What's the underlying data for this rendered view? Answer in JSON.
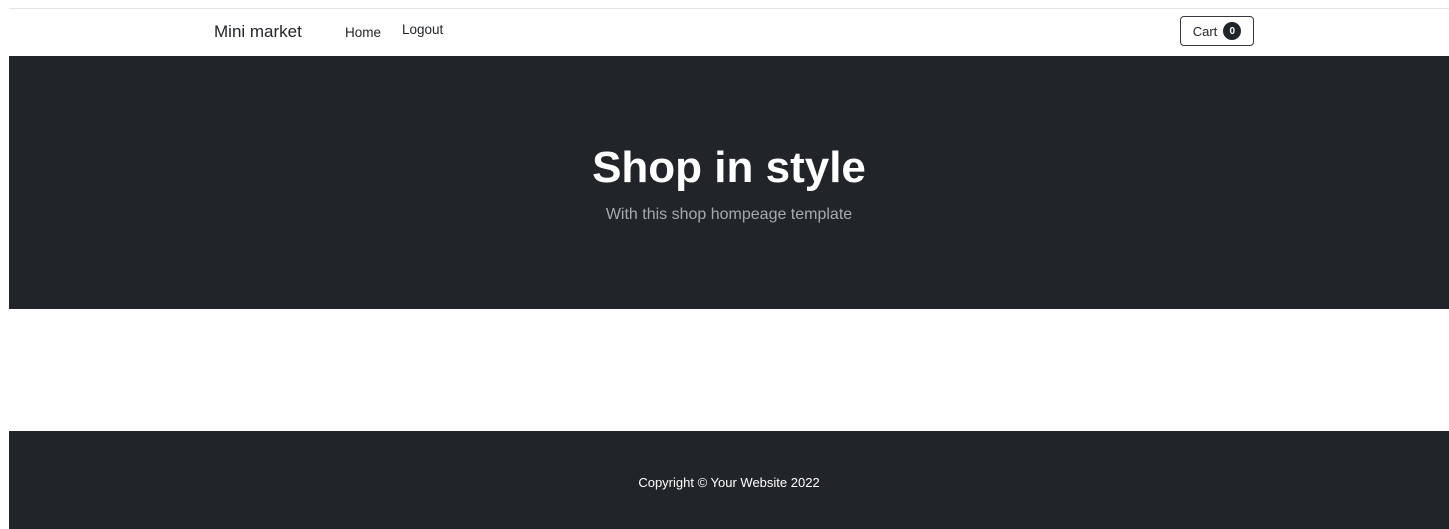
{
  "navbar": {
    "brand": "Mini market",
    "links": [
      {
        "label": "Home"
      },
      {
        "label": "Logout"
      }
    ],
    "cart": {
      "label": "Cart",
      "count": "0"
    }
  },
  "hero": {
    "title": "Shop in style",
    "subtitle": "With this shop hompeage template"
  },
  "footer": {
    "copyright": "Copyright © Your Website 2022"
  },
  "colors": {
    "dark_bg": "#212529",
    "subtitle": "#a6a9ad"
  }
}
